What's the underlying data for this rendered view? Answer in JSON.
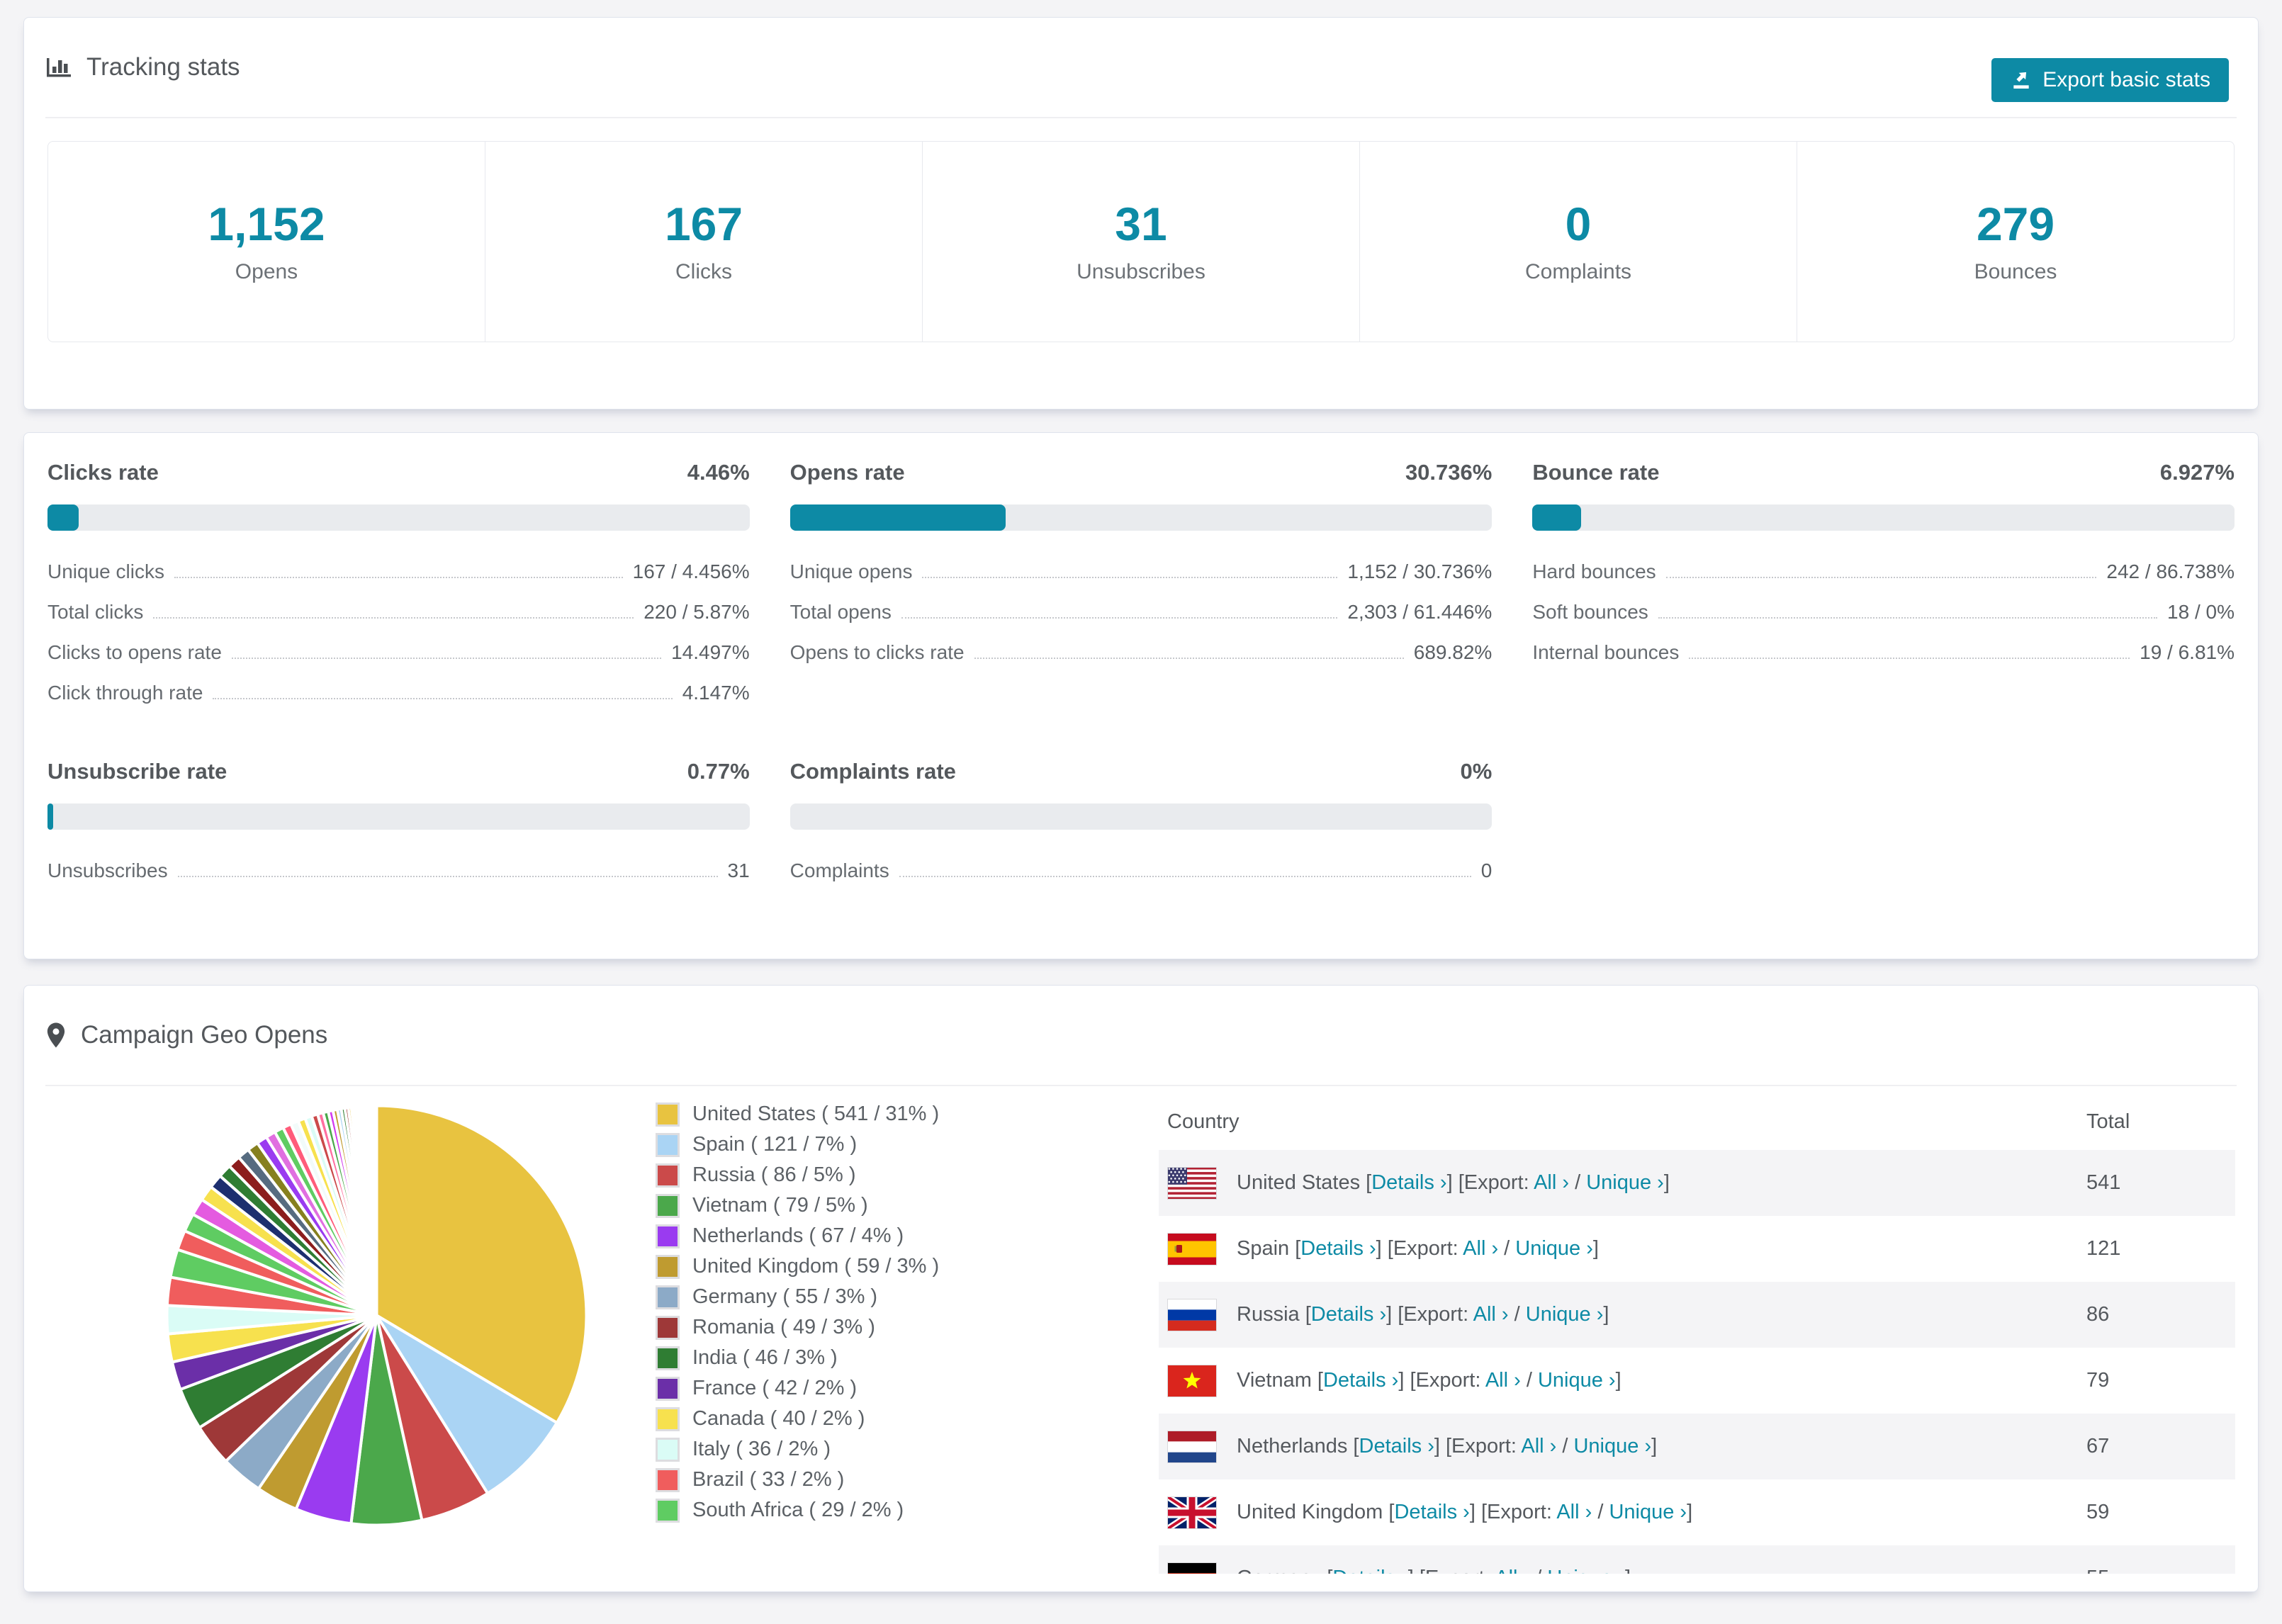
{
  "accent_color": "#0d8aa5",
  "tracking": {
    "title": "Tracking stats",
    "export_button": "Export basic stats",
    "stats": [
      {
        "value": "1,152",
        "label": "Opens"
      },
      {
        "value": "167",
        "label": "Clicks"
      },
      {
        "value": "31",
        "label": "Unsubscribes"
      },
      {
        "value": "0",
        "label": "Complaints"
      },
      {
        "value": "279",
        "label": "Bounces"
      }
    ]
  },
  "rates": [
    {
      "title": "Clicks rate",
      "value": "4.46%",
      "percent": 4.46,
      "rows": [
        {
          "label": "Unique clicks",
          "value": "167 / 4.456%"
        },
        {
          "label": "Total clicks",
          "value": "220 / 5.87%"
        },
        {
          "label": "Clicks to opens rate",
          "value": "14.497%"
        },
        {
          "label": "Click through rate",
          "value": "4.147%"
        }
      ]
    },
    {
      "title": "Opens rate",
      "value": "30.736%",
      "percent": 30.736,
      "rows": [
        {
          "label": "Unique opens",
          "value": "1,152 / 30.736%"
        },
        {
          "label": "Total opens",
          "value": "2,303 / 61.446%"
        },
        {
          "label": "Opens to clicks rate",
          "value": "689.82%"
        }
      ]
    },
    {
      "title": "Bounce rate",
      "value": "6.927%",
      "percent": 6.927,
      "rows": [
        {
          "label": "Hard bounces",
          "value": "242 / 86.738%"
        },
        {
          "label": "Soft bounces",
          "value": "18 / 0%"
        },
        {
          "label": "Internal bounces",
          "value": "19 / 6.81%"
        }
      ]
    },
    {
      "title": "Unsubscribe rate",
      "value": "0.77%",
      "percent": 0.77,
      "rows": [
        {
          "label": "Unsubscribes",
          "value": "31"
        }
      ]
    },
    {
      "title": "Complaints rate",
      "value": "0%",
      "percent": 0,
      "rows": [
        {
          "label": "Complaints",
          "value": "0"
        }
      ]
    }
  ],
  "geo": {
    "title": "Campaign Geo Opens",
    "table": {
      "country_header": "Country",
      "total_header": "Total",
      "details_link": "Details ›",
      "export_prefix": "Export:",
      "all_link": "All ›",
      "unique_link": "Unique ›",
      "bracket_open": "[",
      "bracket_close": "]",
      "separator": "/"
    },
    "chart_data": {
      "type": "pie",
      "title": "Campaign Geo Opens",
      "legend_position": "right",
      "start_angle_deg": 0,
      "direction": "clockwise",
      "series": [
        {
          "name": "United States",
          "total": 541,
          "pct": 31,
          "color": "#e8c340",
          "flag": "us"
        },
        {
          "name": "Spain",
          "total": 121,
          "pct": 7,
          "color": "#aad4f4",
          "flag": "es"
        },
        {
          "name": "Russia",
          "total": 86,
          "pct": 5,
          "color": "#cb4a4a",
          "flag": "ru"
        },
        {
          "name": "Vietnam",
          "total": 79,
          "pct": 5,
          "color": "#4ba84b",
          "flag": "vn"
        },
        {
          "name": "Netherlands",
          "total": 67,
          "pct": 4,
          "color": "#9a3bf0",
          "flag": "nl"
        },
        {
          "name": "United Kingdom",
          "total": 59,
          "pct": 3,
          "color": "#bf9b30",
          "flag": "gb"
        },
        {
          "name": "Germany",
          "total": 55,
          "pct": 3,
          "color": "#8caac7",
          "flag": "de"
        },
        {
          "name": "Romania",
          "total": 49,
          "pct": 3,
          "color": "#9e3838"
        },
        {
          "name": "India",
          "total": 46,
          "pct": 3,
          "color": "#2f7d33"
        },
        {
          "name": "France",
          "total": 42,
          "pct": 2,
          "color": "#6b2fa8"
        },
        {
          "name": "Canada",
          "total": 40,
          "pct": 2,
          "color": "#f7e14e"
        },
        {
          "name": "Italy",
          "total": 36,
          "pct": 2,
          "color": "#dafcf6"
        },
        {
          "name": "Brazil",
          "total": 33,
          "pct": 2,
          "color": "#f05d5d"
        },
        {
          "name": "South Africa",
          "total": 29,
          "pct": 2,
          "color": "#5fcc62"
        }
      ],
      "others_values": [
        1.4,
        1.3,
        1.2,
        1.1,
        1.0,
        0.95,
        0.9,
        0.85,
        0.8,
        0.75,
        0.7,
        0.65,
        0.6,
        0.56,
        0.52,
        0.48,
        0.44,
        0.4,
        0.37,
        0.34,
        0.31,
        0.28,
        0.26,
        0.24,
        0.22,
        0.2,
        0.18,
        0.16,
        0.15,
        0.13,
        0.12,
        0.11,
        0.1,
        0.09,
        0.08,
        0.08,
        0.07,
        0.07,
        0.06,
        0.06,
        0.06,
        0.06
      ],
      "others_palette": [
        "#f05d5d",
        "#5fcc62",
        "#e45be0",
        "#f7e14e",
        "#1d2f6f",
        "#2f7d33",
        "#8c1d1d",
        "#566b80",
        "#86801f",
        "#9a3bf0",
        "#e06fe0",
        "#5fcc62",
        "#ff5c7a",
        "#f2fbfa",
        "#f7e14e",
        "#dafcf6",
        "#cb4a4a",
        "#ff6fa0",
        "#4ba84b",
        "#d23bf0",
        "#bf9b30",
        "#aad4f4",
        "#2f7d33",
        "#9e3838",
        "#e8c340",
        "#e45be0",
        "#6b2fa8",
        "#cb4a4a",
        "#5fcc62",
        "#aad4f4",
        "#f05d5d",
        "#8caac7",
        "#bf9b30",
        "#1d3f8c",
        "#9a3bf0",
        "#86801f",
        "#e06fe0",
        "#2f7d33",
        "#f7e14e",
        "#9e3838",
        "#aad4f4",
        "#cb4a4a"
      ]
    }
  }
}
